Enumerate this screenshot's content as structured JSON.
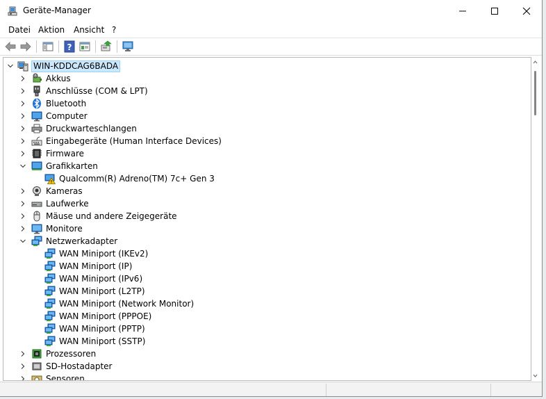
{
  "window": {
    "title": "Geräte-Manager",
    "controls": {
      "minimize": "—",
      "maximize": "☐",
      "close": "✕"
    }
  },
  "menu": [
    {
      "id": "datei",
      "label": "Datei"
    },
    {
      "id": "aktion",
      "label": "Aktion"
    },
    {
      "id": "ansicht",
      "label": "Ansicht"
    },
    {
      "id": "help",
      "label": "?"
    }
  ],
  "toolbar": [
    {
      "name": "back-icon",
      "type": "back"
    },
    {
      "name": "forward-icon",
      "type": "forward"
    },
    {
      "name": "show-hide-console-tree-icon",
      "type": "tree"
    },
    {
      "name": "help-icon",
      "type": "help"
    },
    {
      "name": "properties-icon",
      "type": "props"
    },
    {
      "name": "update-driver-icon",
      "type": "update"
    },
    {
      "name": "monitor-scan-icon",
      "type": "monitor"
    }
  ],
  "tree": {
    "root": {
      "label": "WIN-KDDCAG6BADA",
      "icon": "computer-icon"
    },
    "nodes": [
      {
        "label": "Akkus",
        "icon": "battery-icon",
        "level": 1,
        "expander": "collapsed"
      },
      {
        "label": "Anschlüsse (COM & LPT)",
        "icon": "port-icon",
        "level": 1,
        "expander": "collapsed"
      },
      {
        "label": "Bluetooth",
        "icon": "bluetooth-icon",
        "level": 1,
        "expander": "collapsed"
      },
      {
        "label": "Computer",
        "icon": "computer-monitor-icon",
        "level": 1,
        "expander": "collapsed"
      },
      {
        "label": "Druckwarteschlangen",
        "icon": "printer-icon",
        "level": 1,
        "expander": "collapsed"
      },
      {
        "label": "Eingabegeräte (Human Interface Devices)",
        "icon": "hid-icon",
        "level": 1,
        "expander": "collapsed"
      },
      {
        "label": "Firmware",
        "icon": "chip-icon",
        "level": 1,
        "expander": "collapsed"
      },
      {
        "label": "Grafikkarten",
        "icon": "display-adapter-icon",
        "level": 1,
        "expander": "expanded"
      },
      {
        "label": "Qualcomm(R) Adreno(TM) 7c+ Gen 3",
        "icon": "display-adapter-warning-icon",
        "level": 2,
        "expander": "none"
      },
      {
        "label": "Kameras",
        "icon": "camera-icon",
        "level": 1,
        "expander": "collapsed"
      },
      {
        "label": "Laufwerke",
        "icon": "drive-icon",
        "level": 1,
        "expander": "collapsed"
      },
      {
        "label": "Mäuse und andere Zeigegeräte",
        "icon": "mouse-icon",
        "level": 1,
        "expander": "collapsed"
      },
      {
        "label": "Monitore",
        "icon": "monitor-icon",
        "level": 1,
        "expander": "collapsed"
      },
      {
        "label": "Netzwerkadapter",
        "icon": "network-adapter-icon",
        "level": 1,
        "expander": "expanded"
      },
      {
        "label": "WAN Miniport (IKEv2)",
        "icon": "network-adapter-icon",
        "level": 2,
        "expander": "none"
      },
      {
        "label": "WAN Miniport (IP)",
        "icon": "network-adapter-icon",
        "level": 2,
        "expander": "none"
      },
      {
        "label": "WAN Miniport (IPv6)",
        "icon": "network-adapter-icon",
        "level": 2,
        "expander": "none"
      },
      {
        "label": "WAN Miniport (L2TP)",
        "icon": "network-adapter-icon",
        "level": 2,
        "expander": "none"
      },
      {
        "label": "WAN Miniport (Network Monitor)",
        "icon": "network-adapter-icon",
        "level": 2,
        "expander": "none"
      },
      {
        "label": "WAN Miniport (PPPOE)",
        "icon": "network-adapter-icon",
        "level": 2,
        "expander": "none"
      },
      {
        "label": "WAN Miniport (PPTP)",
        "icon": "network-adapter-icon",
        "level": 2,
        "expander": "none"
      },
      {
        "label": "WAN Miniport (SSTP)",
        "icon": "network-adapter-icon",
        "level": 2,
        "expander": "none"
      },
      {
        "label": "Prozessoren",
        "icon": "processor-icon",
        "level": 1,
        "expander": "collapsed"
      },
      {
        "label": "SD-Hostadapter",
        "icon": "sd-host-icon",
        "level": 1,
        "expander": "collapsed"
      },
      {
        "label": "Sensoren",
        "icon": "sensor-icon",
        "level": 1,
        "expander": "collapsed"
      }
    ]
  },
  "colors": {
    "selection": "#cce8ff",
    "accent": "#0078d4",
    "warning": "#f5c400"
  }
}
